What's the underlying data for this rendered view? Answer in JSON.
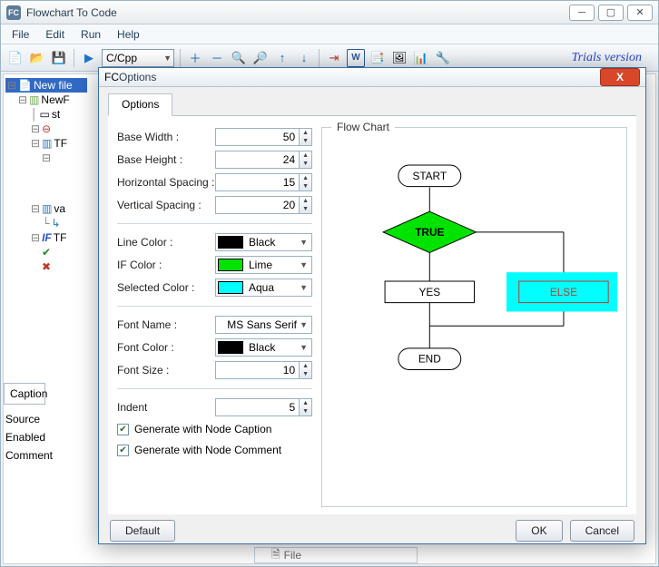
{
  "window": {
    "title": "Flowchart To Code",
    "menus": [
      "File",
      "Edit",
      "Run",
      "Help"
    ],
    "language_combo": "C/Cpp",
    "trials_text": "Trials version"
  },
  "tree": {
    "new_file": "New file",
    "new_f": "NewF",
    "st": "st",
    "tf1": "TF",
    "va": "va",
    "tf2": "TF"
  },
  "side": {
    "caption_tab": "Caption",
    "source": "Source",
    "enabled": "Enabled",
    "comment": "Comment"
  },
  "status": {
    "file": "File"
  },
  "dialog": {
    "title": "Options",
    "tab": "Options",
    "labels": {
      "base_width": "Base Width :",
      "base_height": "Base Height :",
      "h_spacing": "Horizontal Spacing :",
      "v_spacing": "Vertical Spacing :",
      "line_color": "Line Color :",
      "if_color": "IF Color :",
      "selected_color": "Selected Color :",
      "font_name": "Font Name :",
      "font_color": "Font Color :",
      "font_size": "Font Size :",
      "indent": "Indent"
    },
    "values": {
      "base_width": "50",
      "base_height": "24",
      "h_spacing": "15",
      "v_spacing": "20",
      "line_color": "Black",
      "if_color": "Lime",
      "selected_color": "Aqua",
      "font_name": "MS Sans Serif",
      "font_color": "Black",
      "font_size": "10",
      "indent": "5"
    },
    "colors": {
      "line": "#000000",
      "if": "#00e200",
      "selected": "#00ffff",
      "font": "#000000"
    },
    "checks": {
      "gen_caption": "Generate with Node Caption",
      "gen_comment": "Generate with Node Comment"
    },
    "preview": {
      "legend": "Flow Chart",
      "start": "START",
      "cond": "TRUE",
      "yes": "YES",
      "else": "ELSE",
      "end": "END"
    },
    "buttons": {
      "default": "Default",
      "ok": "OK",
      "cancel": "Cancel"
    }
  }
}
